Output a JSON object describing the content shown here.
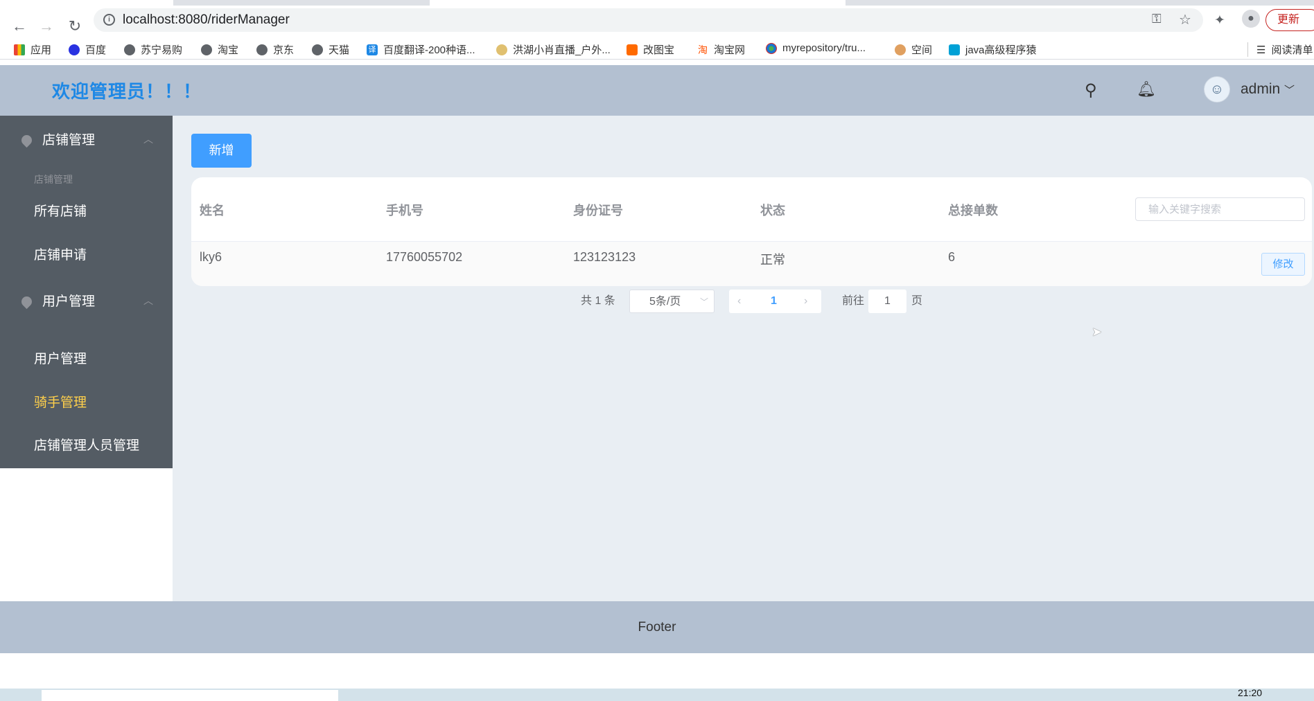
{
  "browser": {
    "url": "localhost:8080/riderManager",
    "update_label": "更新",
    "bookmarks": [
      {
        "label": "应用",
        "icon": "apps-grid-icon"
      },
      {
        "label": "百度",
        "icon": "baidu-icon"
      },
      {
        "label": "苏宁易购",
        "icon": "globe-icon"
      },
      {
        "label": "淘宝",
        "icon": "globe-icon"
      },
      {
        "label": "京东",
        "icon": "globe-icon"
      },
      {
        "label": "天猫",
        "icon": "globe-icon"
      },
      {
        "label": "百度翻译-200种语...",
        "icon": "translate-icon"
      },
      {
        "label": "洪湖小肖直播_户外...",
        "icon": "site-icon"
      },
      {
        "label": "改图宝",
        "icon": "site-icon"
      },
      {
        "label": "淘宝网",
        "icon": "taobao-icon"
      },
      {
        "label": "myrepository/tru...",
        "icon": "site-icon"
      },
      {
        "label": "空间",
        "icon": "qzone-icon"
      },
      {
        "label": "java高级程序猿",
        "icon": "bilibili-icon"
      }
    ],
    "reading_list": "阅读清单"
  },
  "header": {
    "title": "欢迎管理员！！！",
    "user": "admin"
  },
  "sidebar": {
    "menus": [
      {
        "label": "店铺管理",
        "group": "店铺管理",
        "items": [
          "所有店铺",
          "店铺申请"
        ]
      },
      {
        "label": "用户管理",
        "items": [
          "用户管理",
          "骑手管理",
          "店铺管理人员管理"
        ]
      }
    ],
    "active": "骑手管理"
  },
  "main": {
    "add_label": "新增",
    "columns": [
      "姓名",
      "手机号",
      "身份证号",
      "状态",
      "总接单数"
    ],
    "search_placeholder": "输入关键字搜索",
    "rows": [
      {
        "cells": [
          "lky6",
          "17760055702",
          "123123123",
          "正常",
          "6"
        ],
        "action": "修改"
      }
    ],
    "pagination": {
      "total": "共 1 条",
      "page_size": "5条/页",
      "current": "1",
      "goto_label": "前往",
      "goto_value": "1",
      "page_suffix": "页"
    }
  },
  "footer": {
    "text": "Footer"
  },
  "taskbar": {
    "time": "21:20"
  }
}
